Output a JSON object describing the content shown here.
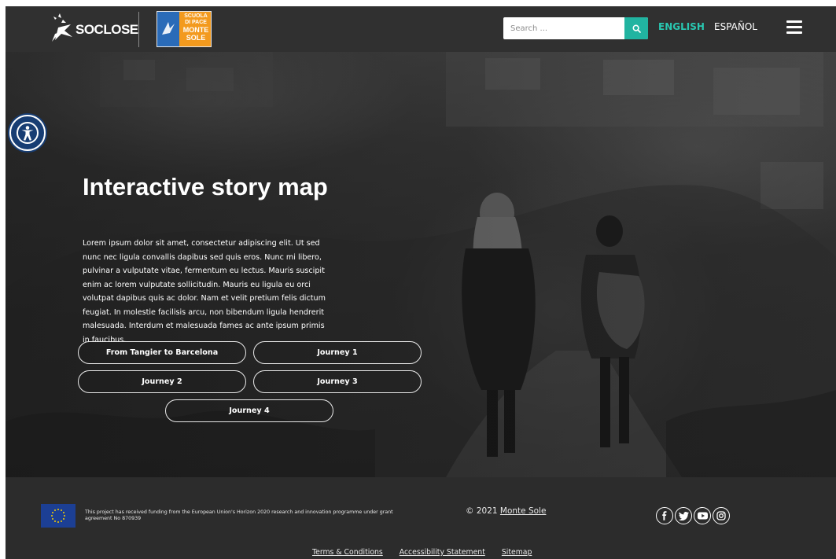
{
  "header": {
    "logo_soclose": "SOCLOSE",
    "logo_montesole_lines": [
      "SCUOLA",
      "DI PACE",
      "MONTE",
      "SOLE"
    ],
    "search": {
      "placeholder": "Search ...",
      "icon": "search-icon"
    },
    "languages": [
      {
        "label": "ENGLISH",
        "active": true
      },
      {
        "label": "ESPAÑOL",
        "active": false
      }
    ],
    "menu_icon": "hamburger-menu-icon"
  },
  "accessibility": {
    "icon": "accessibility-icon",
    "color": "#173d73"
  },
  "hero": {
    "title": "Interactive story map",
    "body": "Lorem ipsum dolor sit amet, consectetur adipiscing elit. Ut sed nunc nec ligula convallis dapibus sed quis eros. Nunc mi libero, pulvinar a vulputate vitae, fermentum eu lectus. Mauris suscipit enim ac lorem vulputate sollicitudin. Mauris eu ligula eu orci volutpat dapibus quis ac dolor. Nam et velit pretium felis dictum feugiat. In molestie facilisis arcu, non bibendum ligula hendrerit malesuada. Interdum et malesuada fames ac ante ipsum primis in faucibus.",
    "journeys": [
      "From Tangier to Barcelona",
      "Journey 1",
      "Journey 2",
      "Journey 3",
      "Journey 4"
    ]
  },
  "footer": {
    "eu_funding_text": "This project has received funding from the European Union's Horizon 2020 research and innovation programme under grant agreement No 870939",
    "copyright_prefix": "© 2021 ",
    "copyright_link": "Monte Sole",
    "social_icons": [
      "facebook-icon",
      "twitter-icon",
      "youtube-icon",
      "instagram-icon"
    ],
    "links": [
      "Terms & Conditions",
      "Accessibility Statement",
      "Sitemap"
    ]
  },
  "colors": {
    "accent": "#21b4a1",
    "active_language": "#29c7b1",
    "header_bg": "#303030",
    "footer_bg": "#2c2c2c",
    "eu_flag": "#1c3f94"
  }
}
